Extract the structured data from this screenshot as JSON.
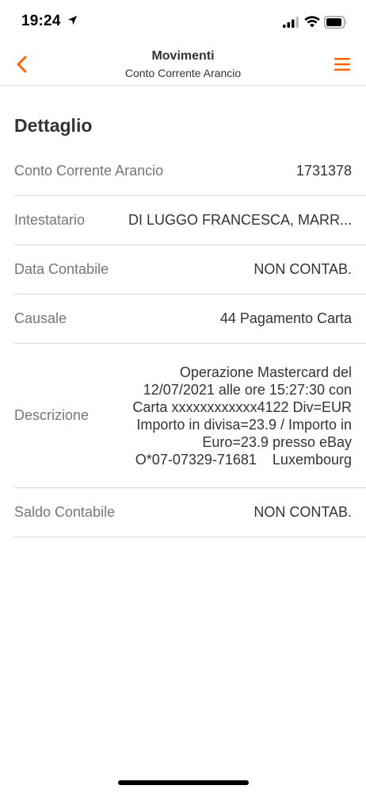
{
  "status_bar": {
    "time": "19:24",
    "icons": [
      "location-arrow-icon",
      "cellular-signal-icon",
      "wifi-icon",
      "battery-icon"
    ]
  },
  "header": {
    "title": "Movimenti",
    "subtitle": "Conto Corrente Arancio",
    "back_icon": "chevron-left-icon",
    "menu_icon": "hamburger-menu-icon",
    "accent_color": "#ff6200"
  },
  "section": {
    "title": "Dettaglio"
  },
  "details": [
    {
      "label": "Conto Corrente Arancio",
      "value": "1731378"
    },
    {
      "label": "Intestatario",
      "value": "DI LUGGO FRANCESCA, MARR..."
    },
    {
      "label": "Data Contabile",
      "value": "NON CONTAB."
    },
    {
      "label": "Causale",
      "value": "44 Pagamento Carta"
    },
    {
      "label": "Descrizione",
      "value_lines": [
        "Operazione Mastercard del",
        "12/07/2021 alle ore 15:27:30 con",
        "Carta xxxxxxxxxxxx4122 Div=EUR",
        "Importo in divisa=23.9 / Importo in",
        "Euro=23.9 presso eBay",
        "O*07-07329-71681    Luxembourg"
      ]
    },
    {
      "label": "Saldo Contabile",
      "value": "NON CONTAB."
    }
  ]
}
